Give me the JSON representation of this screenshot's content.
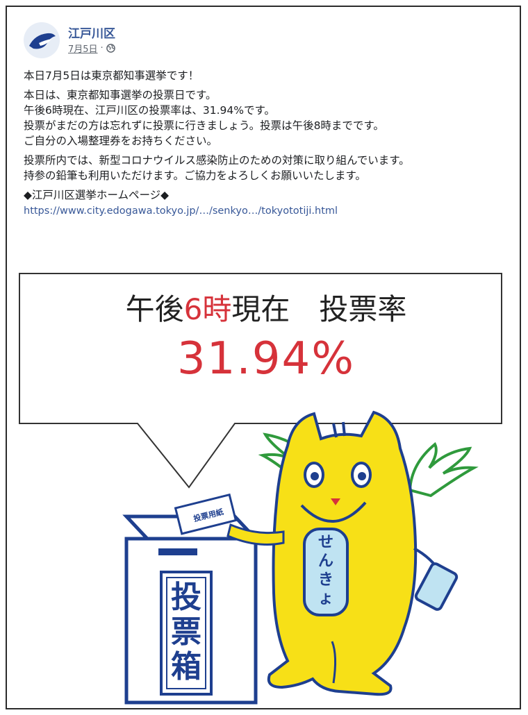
{
  "post": {
    "page_name": "江戸川区",
    "date": "7月5日",
    "separator": "·",
    "paragraphs": [
      "本日7月5日は東京都知事選挙です！",
      "本日は、東京都知事選挙の投票日です。",
      "午後6時現在、江戸川区の投票率は、31.94%です。",
      "投票がまだの方は忘れずに投票に行きましょう。投票は午後8時までです。",
      "ご自分の入場整理券をお持ちください。",
      "投票所内では、新型コロナウイルス感染防止のための対策に取り組んでいます。",
      "持参の鉛筆も利用いただけます。ご協力をよろしくお願いいたします。",
      "◆江戸川区選挙ホームページ◆"
    ],
    "link": "https://www.city.edogawa.tokyo.jp/…/senkyo…/tokyototiji.html"
  },
  "illustration": {
    "line1_pre": "午後",
    "line1_red": "6時",
    "line1_post": "現在　投票率",
    "rate": "31.94%",
    "ballot_label": "投票用紙",
    "box_label": "投票箱",
    "mascot_tag": "せんきょ",
    "colors": {
      "accent_red": "#d6323a",
      "box_blue": "#1e3f8f",
      "mascot_yellow": "#f7e017",
      "wing_green": "#2f9a3c",
      "link_blue": "#385898"
    }
  }
}
